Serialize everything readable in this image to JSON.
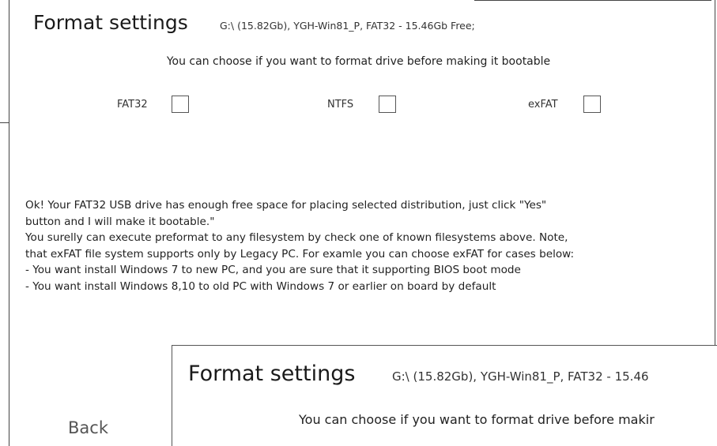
{
  "panel": {
    "title": "Format settings",
    "drive_info": "G:\\ (15.82Gb), YGH-Win81_P, FAT32 - 15.46Gb Free;",
    "subtitle": "You can choose if you want to format drive before making it bootable"
  },
  "filesystems": [
    {
      "label": "FAT32",
      "checked": false
    },
    {
      "label": "NTFS",
      "checked": false
    },
    {
      "label": "exFAT",
      "checked": false
    }
  ],
  "message": {
    "lines": [
      "  Ok! Your FAT32 USB drive has enough free space for placing selected distribution, just click \"Yes\"",
      "button and I will make it bootable.\"",
      "  You surelly can execute preformat to any filesystem by check one of known filesystems above. Note,",
      "that exFAT file system supports only by Legacy PC. For examle you can choose exFAT for cases below:",
      "  - You want install Windows 7 to new PC, and you are sure that it supporting BIOS boot mode",
      "  - You want install Windows 8,10 to old PC with Windows 7 or earlier on board by default"
    ]
  },
  "navigation": {
    "back_label": "Back"
  },
  "overlay": {
    "title": "Format settings",
    "drive_info": "G:\\ (15.82Gb), YGH-Win81_P, FAT32 - 15.46",
    "subtitle": "You can choose if you want to format drive before makir"
  }
}
